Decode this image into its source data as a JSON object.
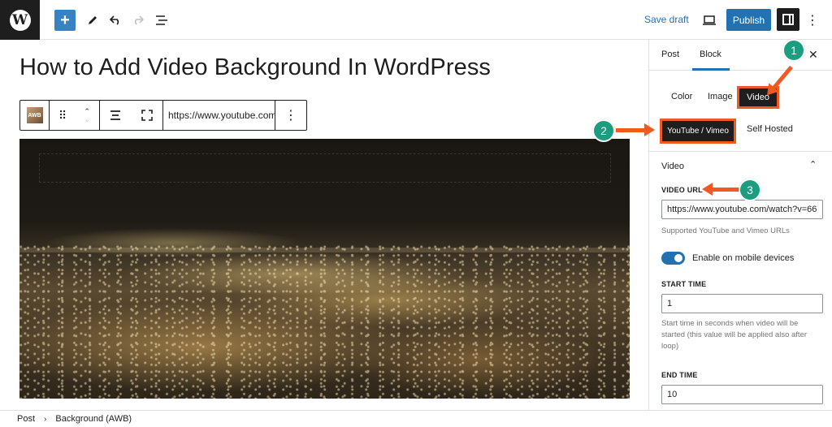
{
  "topbar": {
    "logo": "wordpress-logo",
    "logo_glyph": "W",
    "add_icon": "+",
    "save_draft": "Save draft",
    "publish": "Publish"
  },
  "editor": {
    "title": "How to Add Video Background In WordPress",
    "block_toolbar": {
      "block_icon_text": "AWB",
      "url_value": "https://www.youtube.com"
    }
  },
  "sidebar": {
    "tabs": [
      {
        "label": "Post"
      },
      {
        "label": "Block"
      }
    ],
    "bg_types": [
      {
        "label": "Color"
      },
      {
        "label": "Image"
      },
      {
        "label": "Video"
      }
    ],
    "video_sources": [
      {
        "label": "YouTube / Vimeo"
      },
      {
        "label": "Self Hosted"
      }
    ],
    "section_title": "Video",
    "video_url": {
      "label": "VIDEO URL",
      "value": "https://www.youtube.com/watch?v=66",
      "help": "Supported YouTube and Vimeo URLs"
    },
    "mobile_toggle": {
      "label": "Enable on mobile devices",
      "enabled": true
    },
    "start_time": {
      "label": "START TIME",
      "value": "1",
      "help": "Start time in seconds when video will be started (this value will be applied also after loop)"
    },
    "end_time": {
      "label": "END TIME",
      "value": "10"
    }
  },
  "breadcrumb": {
    "items": [
      "Post",
      "Background (AWB)"
    ]
  },
  "annotations": {
    "steps": [
      "1",
      "2",
      "3"
    ],
    "color": "#ef5a24",
    "badge_color": "#1a9e7f"
  },
  "colors": {
    "accent": "#2271b1",
    "dark": "#1e1e1e"
  }
}
